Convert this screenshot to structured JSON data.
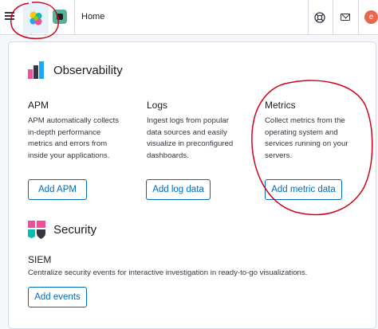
{
  "header": {
    "breadcrumb": "Home",
    "avatar_initial": "e"
  },
  "observability": {
    "title": "Observability",
    "columns": [
      {
        "title": "APM",
        "description": "APM automatically collects in-depth performance metrics and errors from inside your applications.",
        "button": "Add APM"
      },
      {
        "title": "Logs",
        "description": "Ingest logs from popular data sources and easily visualize in preconfigured dashboards.",
        "button": "Add log data"
      },
      {
        "title": "Metrics",
        "description": "Collect metrics from the operating system and services running on your servers.",
        "button": "Add metric data"
      }
    ]
  },
  "security": {
    "title": "Security",
    "subtitle": "SIEM",
    "description": "Centralize security events for interactive investigation in ready-to-go visualizations.",
    "button": "Add events"
  },
  "colors": {
    "accent": "#006bb8",
    "annotation": "#d0021b",
    "avatar": "#e7664c"
  }
}
